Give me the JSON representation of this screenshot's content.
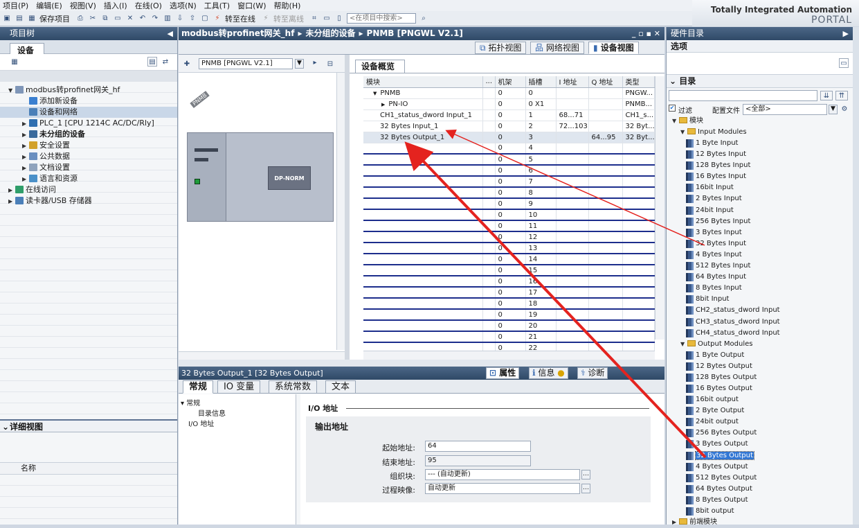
{
  "menubar": [
    "项目(P)",
    "编辑(E)",
    "视图(V)",
    "插入(I)",
    "在线(O)",
    "选项(N)",
    "工具(T)",
    "窗口(W)",
    "帮助(H)"
  ],
  "toolbar": {
    "save": "保存项目",
    "go_online": "转至在线",
    "go_offline": "转至离线",
    "search_placeholder": "<在项目中搜索>"
  },
  "brand": {
    "line1": "Totally Integrated Automation",
    "line2": "PORTAL"
  },
  "project_tree": {
    "title": "项目树",
    "tab": "设备",
    "items": [
      {
        "label": "modbus转profinet网关_hf",
        "level": 0
      },
      {
        "label": "添加新设备",
        "level": 1
      },
      {
        "label": "设备和网络",
        "level": 1
      },
      {
        "label": "PLC_1 [CPU 1214C AC/DC/Rly]",
        "level": 1
      },
      {
        "label": "未分组的设备",
        "level": 1
      },
      {
        "label": "安全设置",
        "level": 1
      },
      {
        "label": "公共数据",
        "level": 1
      },
      {
        "label": "文档设置",
        "level": 1
      },
      {
        "label": "语言和资源",
        "level": 1
      },
      {
        "label": "在线访问",
        "level": 0
      },
      {
        "label": "读卡器/USB 存储器",
        "level": 0
      }
    ]
  },
  "detail_view": {
    "title": "详细视图",
    "col_name": "名称"
  },
  "editor": {
    "breadcrumb": [
      "modbus转profinet网关_hf",
      "未分组的设备",
      "PNMB [PNGWL V2.1]"
    ],
    "views": [
      "拓扑视图",
      "网络视图",
      "设备视图"
    ],
    "device_select": "PNMB [PNGWL V2.1]",
    "device_label": "PNMB",
    "module_label": "DP-NORM",
    "overview_tab": "设备概览",
    "columns": [
      "模块",
      "...",
      "机架",
      "插槽",
      "I 地址",
      "Q 地址",
      "类型"
    ],
    "rows": [
      {
        "module": "PNMB",
        "rack": "0",
        "slot": "0",
        "iaddr": "",
        "qaddr": "",
        "type": "PNGW..."
      },
      {
        "module": "PN-IO",
        "rack": "0",
        "slot": "0 X1",
        "iaddr": "",
        "qaddr": "",
        "type": "PNMB..."
      },
      {
        "module": "CH1_status_dword Input_1",
        "rack": "0",
        "slot": "1",
        "iaddr": "68...71",
        "qaddr": "",
        "type": "CH1_s..."
      },
      {
        "module": "32 Bytes Input_1",
        "rack": "0",
        "slot": "2",
        "iaddr": "72...103",
        "qaddr": "",
        "type": "32 Byt..."
      },
      {
        "module": "32 Bytes Output_1",
        "rack": "0",
        "slot": "3",
        "iaddr": "",
        "qaddr": "64...95",
        "type": "32 Byt..."
      }
    ],
    "empty_slots": [
      "4",
      "5",
      "6",
      "7",
      "8",
      "9",
      "10",
      "11",
      "12",
      "13",
      "14",
      "15",
      "16",
      "17",
      "18",
      "19",
      "20",
      "21",
      "22"
    ]
  },
  "properties": {
    "title": "32 Bytes Output_1 [32 Bytes Output]",
    "side_tabs": [
      "属性",
      "信息",
      "诊断"
    ],
    "tabs": [
      "常规",
      "IO 变量",
      "系统常数",
      "文本"
    ],
    "nav": [
      "常规",
      "目录信息",
      "I/O 地址"
    ],
    "section": "I/O 地址",
    "group": "输出地址",
    "start_label": "起始地址:",
    "start_value": "64",
    "end_label": "结束地址:",
    "end_value": "95",
    "ob_label": "组织块:",
    "ob_value": "--- (自动更新)",
    "pi_label": "过程映像:",
    "pi_value": "自动更新"
  },
  "catalog": {
    "title": "硬件目录",
    "options": "选项",
    "catalog_label": "目录",
    "filter": "过滤",
    "profile_label": "配置文件",
    "profile_value": "<全部>",
    "root": "模块",
    "input_folder": "Input Modules",
    "inputs": [
      "1 Byte Input",
      "12 Bytes Input",
      "128 Bytes Input",
      "16 Bytes Input",
      "16bit Input",
      "2 Bytes Input",
      "24bit Input",
      "256 Bytes Input",
      "3 Bytes Input",
      "32 Bytes Input",
      "4 Bytes Input",
      "512 Bytes Input",
      "64 Bytes Input",
      "8 Bytes Input",
      "8bit Input",
      "CH2_status_dword Input",
      "CH3_status_dword Input",
      "CH4_status_dword Input"
    ],
    "output_folder": "Output Modules",
    "outputs": [
      "1 Byte Output",
      "12 Bytes Output",
      "128 Bytes Output",
      "16 Bytes Output",
      "16bit output",
      "2 Byte Output",
      "24bit output",
      "256 Bytes Output",
      "3 Bytes Output",
      "32 Bytes Output",
      "4 Bytes Output",
      "512 Bytes Output",
      "64 Bytes Output",
      "8 Bytes Output",
      "8bit output"
    ],
    "selected": "32 Bytes Output",
    "next_folder": "前端模块"
  },
  "colors": {
    "header": "#3a5578",
    "selection": "#3277d4",
    "arrow": "#e4231f",
    "row_line": "#1c2d8c"
  }
}
